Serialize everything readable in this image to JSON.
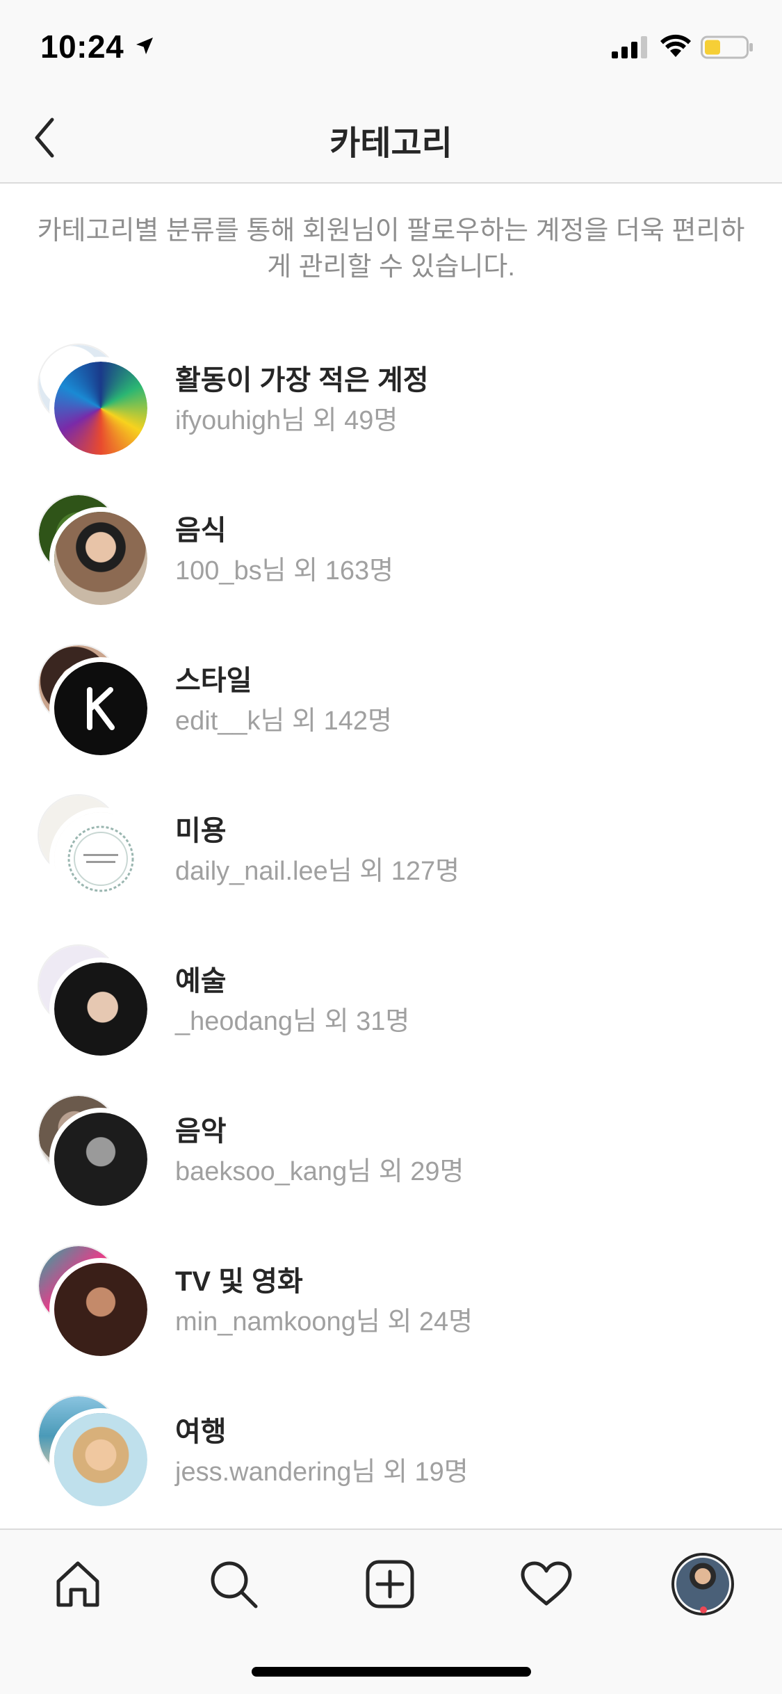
{
  "status_bar": {
    "time": "10:24"
  },
  "header": {
    "title": "카테고리"
  },
  "description": "카테고리별 분류를 통해 회원님이 팔로우하는 계정을 더욱 편리하게 관리할 수 있습니다.",
  "categories": [
    {
      "name": "활동이 가장 적은 계정",
      "subtitle": "ifyouhigh님 외 49명"
    },
    {
      "name": "음식",
      "subtitle": "100_bs님 외 163명"
    },
    {
      "name": "스타일",
      "subtitle": "edit__k님 외 142명"
    },
    {
      "name": "미용",
      "subtitle": "daily_nail.lee님 외 127명"
    },
    {
      "name": "예술",
      "subtitle": "_heodang님 외 31명"
    },
    {
      "name": "음악",
      "subtitle": "baeksoo_kang님 외 29명"
    },
    {
      "name": "TV 및 영화",
      "subtitle": "min_namkoong님 외 24명"
    },
    {
      "name": "여행",
      "subtitle": "jess.wandering님 외 19명"
    }
  ],
  "tab_bar": {
    "tabs": [
      "home-icon",
      "search-icon",
      "new-post-icon",
      "activity-heart-icon",
      "profile-avatar"
    ]
  },
  "colors": {
    "notification_dot": "#ed4956",
    "secondary_text": "#8e8e8e",
    "primary_text": "#262626"
  }
}
